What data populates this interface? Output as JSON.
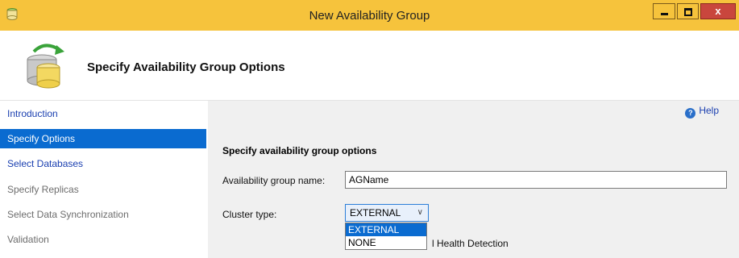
{
  "window": {
    "title": "New Availability Group",
    "close_glyph": "x"
  },
  "header": {
    "title": "Specify Availability Group Options",
    "icon": "database-refresh-icon"
  },
  "nav": {
    "items": [
      {
        "label": "Introduction",
        "state": "link"
      },
      {
        "label": "Specify Options",
        "state": "selected"
      },
      {
        "label": "Select Databases",
        "state": "link"
      },
      {
        "label": "Specify Replicas",
        "state": "disabled"
      },
      {
        "label": "Select Data Synchronization",
        "state": "disabled"
      },
      {
        "label": "Validation",
        "state": "disabled"
      }
    ]
  },
  "main": {
    "help_label": "Help",
    "help_glyph": "?",
    "section_title": "Specify availability group options",
    "ag_name_label": "Availability group name:",
    "ag_name_value": "AGName",
    "cluster_type_label": "Cluster type:",
    "cluster_type_value": "EXTERNAL",
    "cluster_type_options": [
      "EXTERNAL",
      "NONE"
    ],
    "obscured_checkbox_fragment": "l Health Detection"
  },
  "colors": {
    "titlebar": "#f6c33c",
    "nav_selected": "#0a6bd0",
    "link": "#1a3fb0",
    "close_button": "#c9463d"
  }
}
